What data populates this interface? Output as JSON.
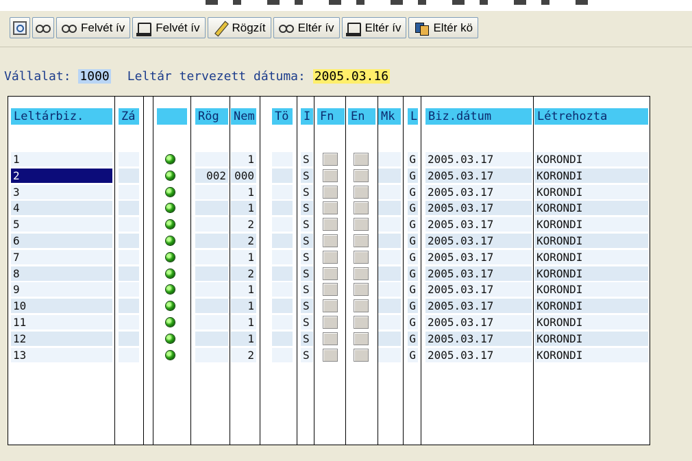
{
  "toolbar": {
    "buttons": [
      {
        "label": "",
        "icon": "magnifier-list-icon"
      },
      {
        "label": "",
        "icon": "glasses-icon"
      },
      {
        "label": "Felvét ív",
        "icon": "glasses-icon"
      },
      {
        "label": "Felvét ív",
        "icon": "printer-icon"
      },
      {
        "label": "Rögzít",
        "icon": "pencil-icon"
      },
      {
        "label": "Eltér ív",
        "icon": "glasses-icon"
      },
      {
        "label": "Eltér ív",
        "icon": "printer-icon"
      },
      {
        "label": "Eltér kö",
        "icon": "copy-icon"
      }
    ]
  },
  "header": {
    "company_label": "Vállalat:",
    "company_value": "1000",
    "date_label": "Leltár tervezett dátuma:",
    "date_value": "2005.03.16"
  },
  "table": {
    "columns": [
      "Leltárbiz.",
      "Zá",
      "",
      "Rög",
      "Nem",
      "Tö",
      "I",
      "Fn",
      "En",
      "Mk",
      "L",
      "Biz.dátum",
      "Létrehozta"
    ],
    "rows": [
      {
        "doc": "1",
        "rog": "",
        "nem": "1",
        "i": "S",
        "l": "G",
        "date": "2005.03.17",
        "creator": "KORONDI"
      },
      {
        "doc": "2",
        "rog": "002",
        "nem": "000",
        "i": "S",
        "l": "G",
        "date": "2005.03.17",
        "creator": "KORONDI"
      },
      {
        "doc": "3",
        "rog": "",
        "nem": "1",
        "i": "S",
        "l": "G",
        "date": "2005.03.17",
        "creator": "KORONDI"
      },
      {
        "doc": "4",
        "rog": "",
        "nem": "1",
        "i": "S",
        "l": "G",
        "date": "2005.03.17",
        "creator": "KORONDI"
      },
      {
        "doc": "5",
        "rog": "",
        "nem": "2",
        "i": "S",
        "l": "G",
        "date": "2005.03.17",
        "creator": "KORONDI"
      },
      {
        "doc": "6",
        "rog": "",
        "nem": "2",
        "i": "S",
        "l": "G",
        "date": "2005.03.17",
        "creator": "KORONDI"
      },
      {
        "doc": "7",
        "rog": "",
        "nem": "1",
        "i": "S",
        "l": "G",
        "date": "2005.03.17",
        "creator": "KORONDI"
      },
      {
        "doc": "8",
        "rog": "",
        "nem": "2",
        "i": "S",
        "l": "G",
        "date": "2005.03.17",
        "creator": "KORONDI"
      },
      {
        "doc": "9",
        "rog": "",
        "nem": "1",
        "i": "S",
        "l": "G",
        "date": "2005.03.17",
        "creator": "KORONDI"
      },
      {
        "doc": "10",
        "rog": "",
        "nem": "1",
        "i": "S",
        "l": "G",
        "date": "2005.03.17",
        "creator": "KORONDI"
      },
      {
        "doc": "11",
        "rog": "",
        "nem": "1",
        "i": "S",
        "l": "G",
        "date": "2005.03.17",
        "creator": "KORONDI"
      },
      {
        "doc": "12",
        "rog": "",
        "nem": "1",
        "i": "S",
        "l": "G",
        "date": "2005.03.17",
        "creator": "KORONDI"
      },
      {
        "doc": "13",
        "rog": "",
        "nem": "2",
        "i": "S",
        "l": "G",
        "date": "2005.03.17",
        "creator": "KORONDI"
      }
    ],
    "selected_row": 1,
    "status_color": "#2ea417"
  }
}
